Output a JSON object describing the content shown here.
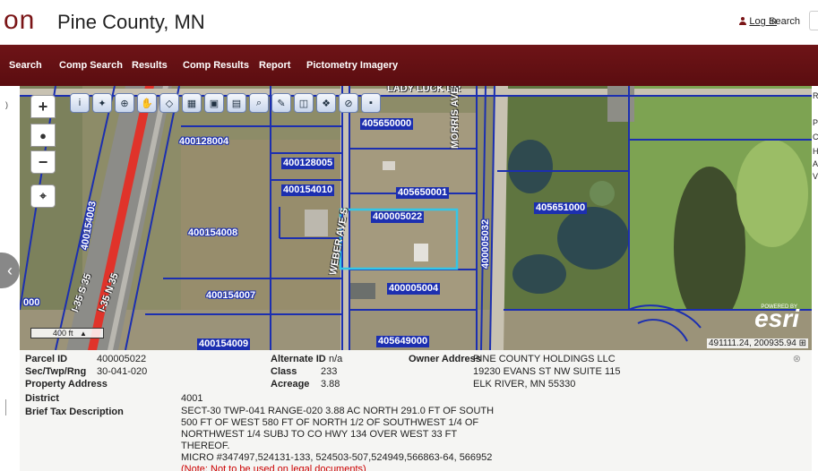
{
  "header": {
    "logo_fragment": "on",
    "site_title": "Pine County, MN",
    "login_label": "Log In",
    "search_label": "Search"
  },
  "nav": {
    "items": [
      "Search",
      "Comp Search",
      "Results",
      "Comp Results",
      "Report",
      "Pictometry Imagery"
    ]
  },
  "map": {
    "toolbar_icons": [
      "info-icon",
      "highlight-icon",
      "zoom-area-icon",
      "pan-icon",
      "eraser-icon",
      "select-icon",
      "layers-icon",
      "buildings-icon",
      "magnify-icon",
      "draw-icon",
      "extent-icon",
      "bookmark-icon",
      "identify-icon",
      "save-icon"
    ],
    "zoom_in": "+",
    "zoom_out": "−",
    "home": "●",
    "locate": "⌖",
    "scale_label": "400 ft",
    "esri_powered": "POWERED BY",
    "esri": "esri",
    "coordinates": "491111.24, 200935.94",
    "parcels": [
      "400128004",
      "400128005",
      "400154010",
      "405650000",
      "405650001",
      "400005022",
      "405651000",
      "400154008",
      "400154007",
      "400005004",
      "400154009",
      "405649000",
      "400154003",
      "400005032",
      "000"
    ],
    "road_labels": [
      "LADY LUCK DR",
      "MORRIS AVE S 134",
      "WEBER AVE S",
      "I-35 S 35",
      "I-35 N 35"
    ],
    "colors": {
      "parcel_line": "#1c2fb0",
      "selected_parcel": "#33c6e8",
      "highway_stripe": "#e0332a"
    }
  },
  "info": {
    "parcel_id_label": "Parcel ID",
    "parcel_id": "400005022",
    "sec_label": "Sec/Twp/Rng",
    "sec_value": "30-041-020",
    "property_address_label": "Property Address",
    "district_label": "District",
    "district_value": "4001",
    "brief_tax_label": "Brief Tax Description",
    "legal_lines": [
      "SECT-30 TWP-041 RANGE-020 3.88 AC NORTH 291.0 FT OF SOUTH",
      "500 FT OF WEST 580 FT OF NORTH 1/2 OF SOUTHWEST 1/4 OF",
      "NORTHWEST 1/4 SUBJ TO CO HWY 134 OVER WEST 33 FT THEREOF.",
      "MICRO #347497,524131-133, 524503-507,524949,566863-64, 566952"
    ],
    "legal_note": "(Note: Not to be used on legal documents)",
    "alternate_id_label": "Alternate ID",
    "alternate_id": "n/a",
    "class_label": "Class",
    "class_value": "233",
    "acreage_label": "Acreage",
    "acreage_value": "3.88",
    "owner_label": "Owner Address",
    "owner_lines": [
      "PINE COUNTY HOLDINGS LLC",
      "19230 EVANS ST NW SUITE 115",
      "ELK RIVER, MN 55330"
    ],
    "close": "⊗"
  },
  "side": {
    "left_collapse": "‹",
    "right_letters": [
      "R",
      "P",
      "C",
      "H",
      "A",
      "V"
    ]
  }
}
